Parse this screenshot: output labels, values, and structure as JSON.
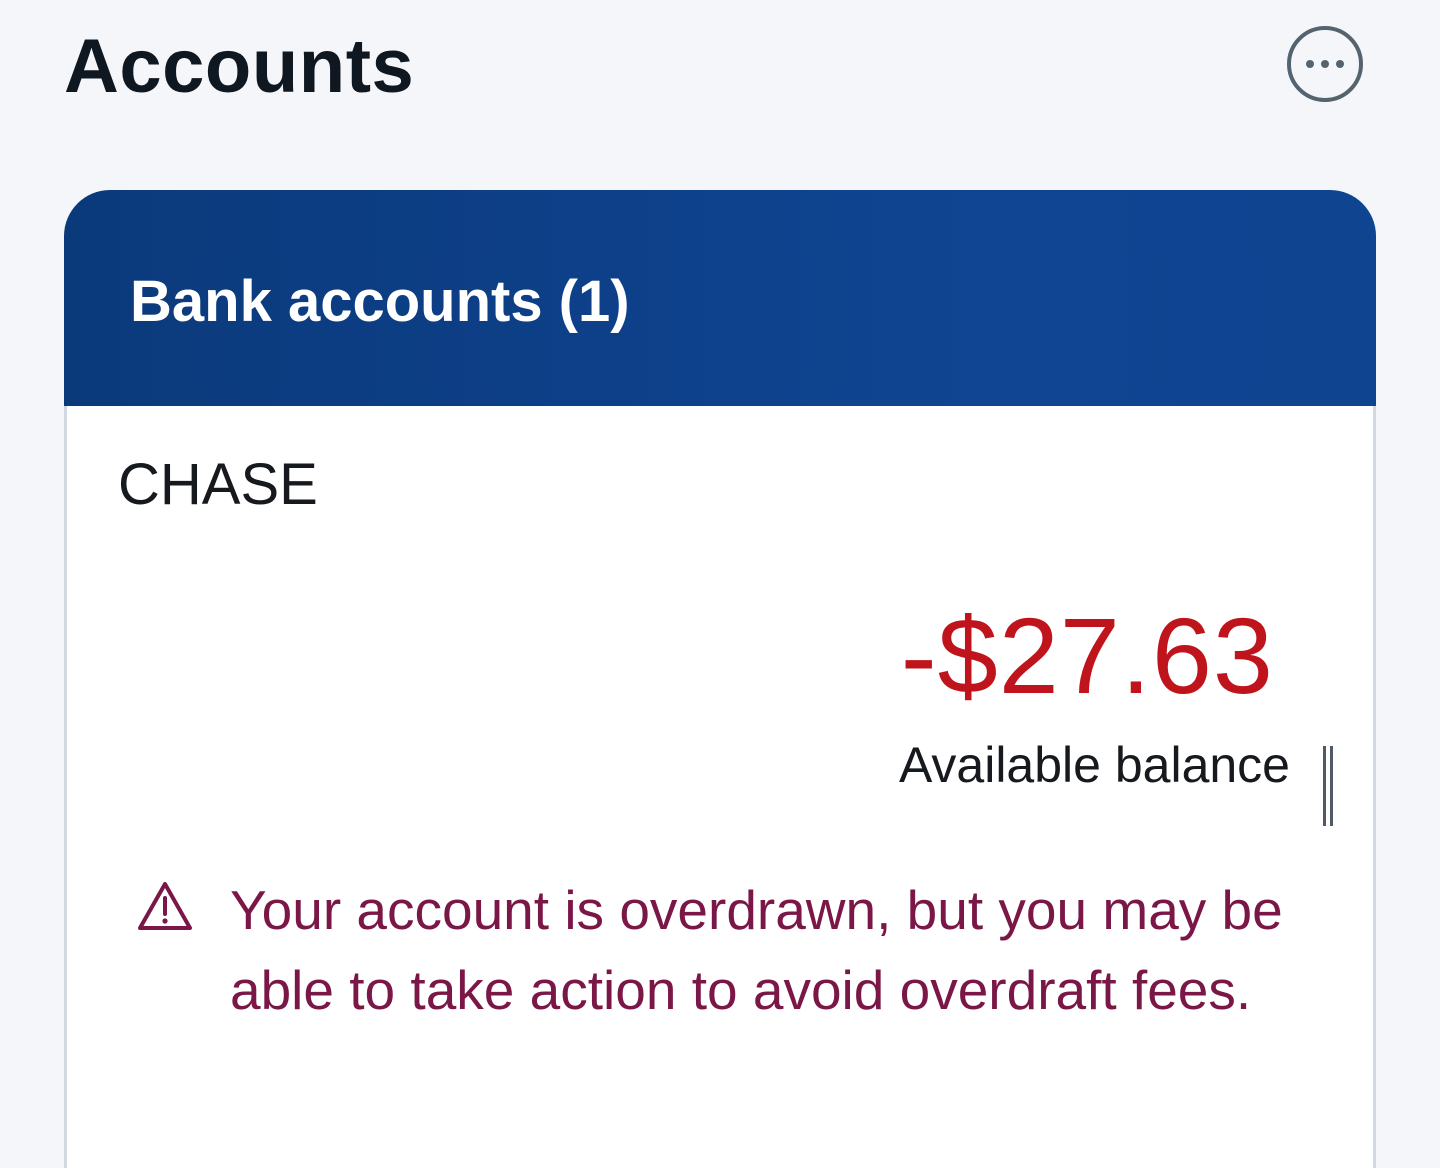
{
  "header": {
    "title": "Accounts",
    "more_icon": "more-horizontal-circle-icon"
  },
  "bank_accounts": {
    "section_title": "Bank accounts (1)",
    "header_color": "#0d3f87",
    "accounts": [
      {
        "name": "CHASE",
        "balance": "-$27.63",
        "balance_label": "Available balance",
        "balance_color": "#c0141d",
        "warning": {
          "icon": "warning-triangle-icon",
          "text": "Your account is overdrawn, but you may be able to take action to avoid overdraft fees.",
          "color": "#7a1747"
        }
      }
    ]
  }
}
